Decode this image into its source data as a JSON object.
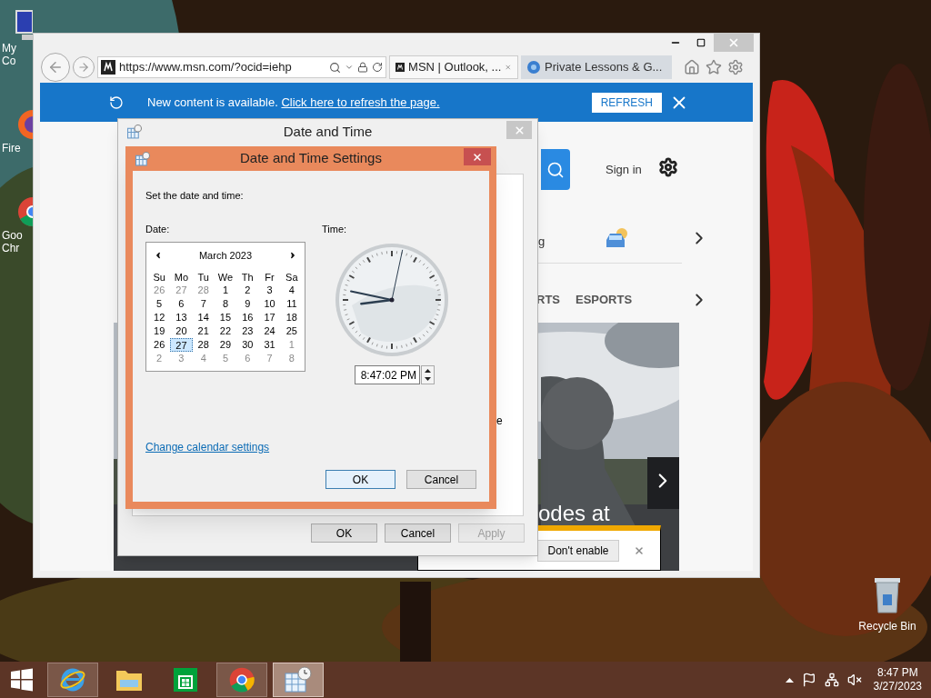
{
  "desktop_icons": [
    {
      "label": "My Co",
      "kind": "computer"
    },
    {
      "label": "Fire",
      "kind": "firefox"
    },
    {
      "label": "Goo Chr",
      "kind": "chrome"
    }
  ],
  "recycle_bin": {
    "label": "Recycle Bin"
  },
  "browser": {
    "address": "https://www.msn.com/?ocid=iehp",
    "tabs": [
      {
        "title": "MSN | Outlook, ...",
        "selected": true
      },
      {
        "title": "Private Lessons & G...",
        "selected": false
      }
    ],
    "notification": {
      "text": "New content is available. ",
      "link": "Click here to refresh the page.",
      "button": "REFRESH"
    },
    "page": {
      "sign_in": "Sign in",
      "fragment": "g",
      "nav_items": [
        "RTS",
        "ESPORTS"
      ],
      "headline": "odes at"
    },
    "security_bar": {
      "button": "Don't enable"
    }
  },
  "back_dialog": {
    "title": "Date and Time",
    "fragment": "e",
    "buttons": [
      {
        "label": "OK",
        "disabled": false
      },
      {
        "label": "Cancel",
        "disabled": false
      },
      {
        "label": "Apply",
        "disabled": true
      }
    ]
  },
  "dialog": {
    "title": "Date and Time Settings",
    "prompt": "Set the date and time:",
    "date_label": "Date:",
    "time_label": "Time:",
    "calendar": {
      "month": "March 2023",
      "weekdays": [
        "Su",
        "Mo",
        "Tu",
        "We",
        "Th",
        "Fr",
        "Sa"
      ],
      "weeks": [
        [
          {
            "day": "26",
            "other_month": true,
            "selected": false
          },
          {
            "day": "27",
            "other_month": true,
            "selected": false
          },
          {
            "day": "28",
            "other_month": true,
            "selected": false
          },
          {
            "day": "1",
            "other_month": false,
            "selected": false
          },
          {
            "day": "2",
            "other_month": false,
            "selected": false
          },
          {
            "day": "3",
            "other_month": false,
            "selected": false
          },
          {
            "day": "4",
            "other_month": false,
            "selected": false
          }
        ],
        [
          {
            "day": "5",
            "other_month": false,
            "selected": false
          },
          {
            "day": "6",
            "other_month": false,
            "selected": false
          },
          {
            "day": "7",
            "other_month": false,
            "selected": false
          },
          {
            "day": "8",
            "other_month": false,
            "selected": false
          },
          {
            "day": "9",
            "other_month": false,
            "selected": false
          },
          {
            "day": "10",
            "other_month": false,
            "selected": false
          },
          {
            "day": "11",
            "other_month": false,
            "selected": false
          }
        ],
        [
          {
            "day": "12",
            "other_month": false,
            "selected": false
          },
          {
            "day": "13",
            "other_month": false,
            "selected": false
          },
          {
            "day": "14",
            "other_month": false,
            "selected": false
          },
          {
            "day": "15",
            "other_month": false,
            "selected": false
          },
          {
            "day": "16",
            "other_month": false,
            "selected": false
          },
          {
            "day": "17",
            "other_month": false,
            "selected": false
          },
          {
            "day": "18",
            "other_month": false,
            "selected": false
          }
        ],
        [
          {
            "day": "19",
            "other_month": false,
            "selected": false
          },
          {
            "day": "20",
            "other_month": false,
            "selected": false
          },
          {
            "day": "21",
            "other_month": false,
            "selected": false
          },
          {
            "day": "22",
            "other_month": false,
            "selected": false
          },
          {
            "day": "23",
            "other_month": false,
            "selected": false
          },
          {
            "day": "24",
            "other_month": false,
            "selected": false
          },
          {
            "day": "25",
            "other_month": false,
            "selected": false
          }
        ],
        [
          {
            "day": "26",
            "other_month": false,
            "selected": false
          },
          {
            "day": "27",
            "other_month": false,
            "selected": true
          },
          {
            "day": "28",
            "other_month": false,
            "selected": false
          },
          {
            "day": "29",
            "other_month": false,
            "selected": false
          },
          {
            "day": "30",
            "other_month": false,
            "selected": false
          },
          {
            "day": "31",
            "other_month": false,
            "selected": false
          },
          {
            "day": "1",
            "other_month": true,
            "selected": false
          }
        ],
        [
          {
            "day": "2",
            "other_month": true,
            "selected": false
          },
          {
            "day": "3",
            "other_month": true,
            "selected": false
          },
          {
            "day": "4",
            "other_month": true,
            "selected": false
          },
          {
            "day": "5",
            "other_month": true,
            "selected": false
          },
          {
            "day": "6",
            "other_month": true,
            "selected": false
          },
          {
            "day": "7",
            "other_month": true,
            "selected": false
          },
          {
            "day": "8",
            "other_month": true,
            "selected": false
          }
        ]
      ]
    },
    "time_value": "8:47:02 PM",
    "link": "Change calendar settings",
    "buttons": [
      {
        "label": "OK",
        "default": true
      },
      {
        "label": "Cancel",
        "default": false
      }
    ]
  },
  "taskbar": {
    "items": [
      {
        "kind": "ie",
        "running": true,
        "selected": false
      },
      {
        "kind": "explorer",
        "running": false,
        "selected": false
      },
      {
        "kind": "store",
        "running": false,
        "selected": false
      },
      {
        "kind": "chrome",
        "running": true,
        "selected": false
      },
      {
        "kind": "datetime",
        "running": true,
        "selected": true
      }
    ],
    "time": "8:47 PM",
    "date": "3/27/2023"
  }
}
